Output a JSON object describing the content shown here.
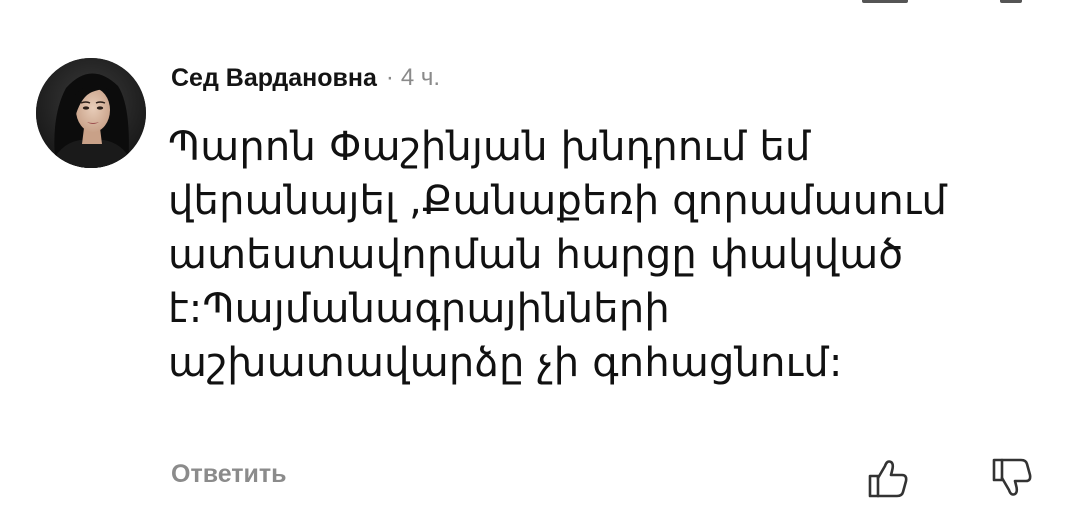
{
  "comment": {
    "author": "Сед Вардановна",
    "separator": "·",
    "time": "4 ч.",
    "text": "Պարոն Փաշինյան խնդրում եմ վերանայել ,Քանաքեռի զորամասում ատեստավորման հարցը փակված է:Պայմանագրայինների աշխատավարձը չի գոհացնում:",
    "avatar_icon": "user-avatar-photo"
  },
  "actions": {
    "reply_label": "Ответить",
    "like_icon": "thumbs-up-icon",
    "dislike_icon": "thumbs-down-icon"
  },
  "colors": {
    "author": "#141414",
    "meta": "#8a8a8a",
    "body": "#111111",
    "reply": "#8b8b8b",
    "icon_stroke": "#333333",
    "background": "#ffffff"
  }
}
